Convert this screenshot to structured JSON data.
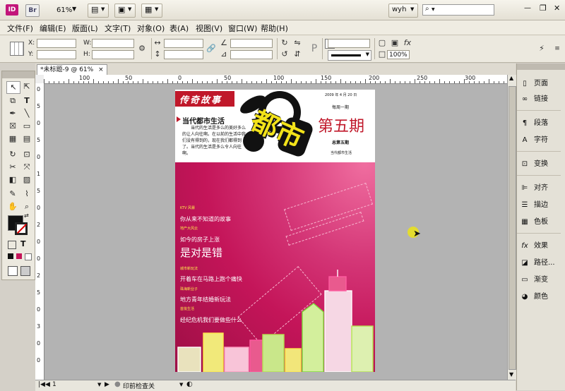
{
  "app": {
    "id_logo": "ID",
    "br_logo": "Br",
    "zoom": "61%",
    "user": "wyh",
    "search_placeholder": "",
    "win_minimize": "—",
    "win_restore": "❐",
    "win_close": "✕"
  },
  "menu": [
    "文件(F)",
    "编辑(E)",
    "版面(L)",
    "文字(T)",
    "对象(O)",
    "表(A)",
    "视图(V)",
    "窗口(W)",
    "帮助(H)"
  ],
  "control": {
    "x_label": "X:",
    "y_label": "Y:",
    "w_label": "W:",
    "h_label": "H:",
    "stroke_weight": "",
    "zoom_pct": "100%"
  },
  "document": {
    "tab_label": "*未标题-9 @ 61%",
    "tab_close": "×",
    "page_number": "1",
    "preflight_label": "印前检查关"
  },
  "ruler": {
    "h_ticks": [
      "100",
      "50",
      "0",
      "50",
      "100",
      "150",
      "200",
      "250",
      "300"
    ],
    "v_ticks": [
      "0",
      "5",
      "0",
      "5",
      "0",
      "1",
      "5",
      "0",
      "2",
      "0",
      "0",
      "2",
      "5",
      "0",
      "3",
      "0",
      "0"
    ]
  },
  "tools": [
    "selection",
    "direct-selection",
    "page",
    "type",
    "pen",
    "pencil",
    "line",
    "rectangle-frame",
    "rectangle",
    "rotate",
    "scale",
    "scissors",
    "free-transform",
    "gradient",
    "note",
    "eyedropper",
    "hand",
    "zoom"
  ],
  "panels": [
    {
      "icon": "page-icon",
      "label": "页面"
    },
    {
      "icon": "link-icon",
      "label": "链接"
    },
    {
      "icon": "paragraph-icon",
      "label": "段落"
    },
    {
      "icon": "character-icon",
      "label": "字符"
    },
    {
      "icon": "transform-icon",
      "label": "变换"
    },
    {
      "icon": "align-icon",
      "label": "对齐"
    },
    {
      "icon": "stroke-icon",
      "label": "描边"
    },
    {
      "icon": "swatches-icon",
      "label": "色板"
    },
    {
      "icon": "effects-icon",
      "label": "效果"
    },
    {
      "icon": "pathfinder-icon",
      "label": "路径..."
    },
    {
      "icon": "gradient-icon",
      "label": "渐变"
    },
    {
      "icon": "color-icon",
      "label": "颜色"
    }
  ],
  "magazine": {
    "banner": "传奇故事",
    "date": "2009 年 4 月 20 日",
    "frequency": "每周一期",
    "headline": "当代都市生活",
    "intro": "当代的生活是多么的美好多么的让人向往啊。在以前的生活中我们没有得到的，现在我们都得到了。当代的生活是多么令人向往啊。",
    "logo": "都市",
    "issue_big": "第五期",
    "issue_small": "总第五期",
    "slogan": "当代都市生活",
    "items": [
      {
        "tag": "KTV 风暴",
        "title": "你从来不知道的故事"
      },
      {
        "tag": "地产大风云",
        "title": "如今的房子上涨"
      },
      {
        "tag": "",
        "title": "是对是错"
      },
      {
        "tag": "城市新玩法",
        "title": "开着车在马路上跑个痛快"
      },
      {
        "tag": "珠海新业子",
        "title": "地方青年结婚新玩法"
      },
      {
        "tag": "首批生活",
        "title": "经纪危机我们要做些什么"
      }
    ]
  },
  "colors": {
    "magenta": "#c41559",
    "banner_red": "#c0182a",
    "logo_yellow": "#f2e21a",
    "tag_yellow": "#ffe84a",
    "cursor_yellow": "#e8e020"
  }
}
